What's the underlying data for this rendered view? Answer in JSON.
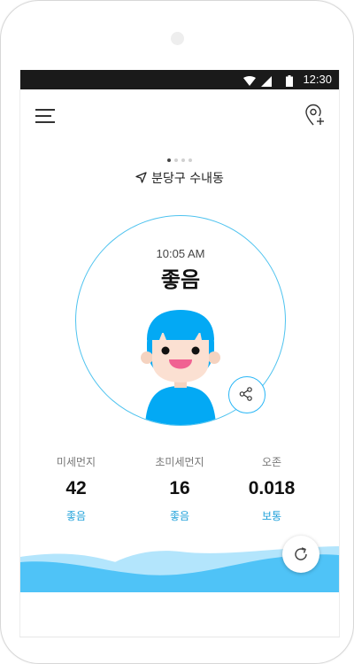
{
  "status_bar": {
    "time": "12:30"
  },
  "header": {
    "menu_icon": "hamburger-menu-icon",
    "add_location_icon": "location-pin-plus-icon"
  },
  "pager": {
    "count": 4,
    "active_index": 0
  },
  "location": {
    "icon": "navigation-arrow-icon",
    "name": "분당구 수내동"
  },
  "summary": {
    "time": "10:05 AM",
    "status": "좋음"
  },
  "metrics": [
    {
      "label": "미세먼지",
      "value": "42",
      "grade": "좋음"
    },
    {
      "label": "초미세먼지",
      "value": "16",
      "grade": "좋음"
    },
    {
      "label": "오존",
      "value": "0.018",
      "grade": "보통"
    }
  ],
  "colors": {
    "accent": "#29B6F6",
    "face_hair": "#03A9F4",
    "grade_text": "#1EA0DA",
    "wave_dark": "#4FC3F7",
    "wave_light": "#B3E5FC"
  }
}
